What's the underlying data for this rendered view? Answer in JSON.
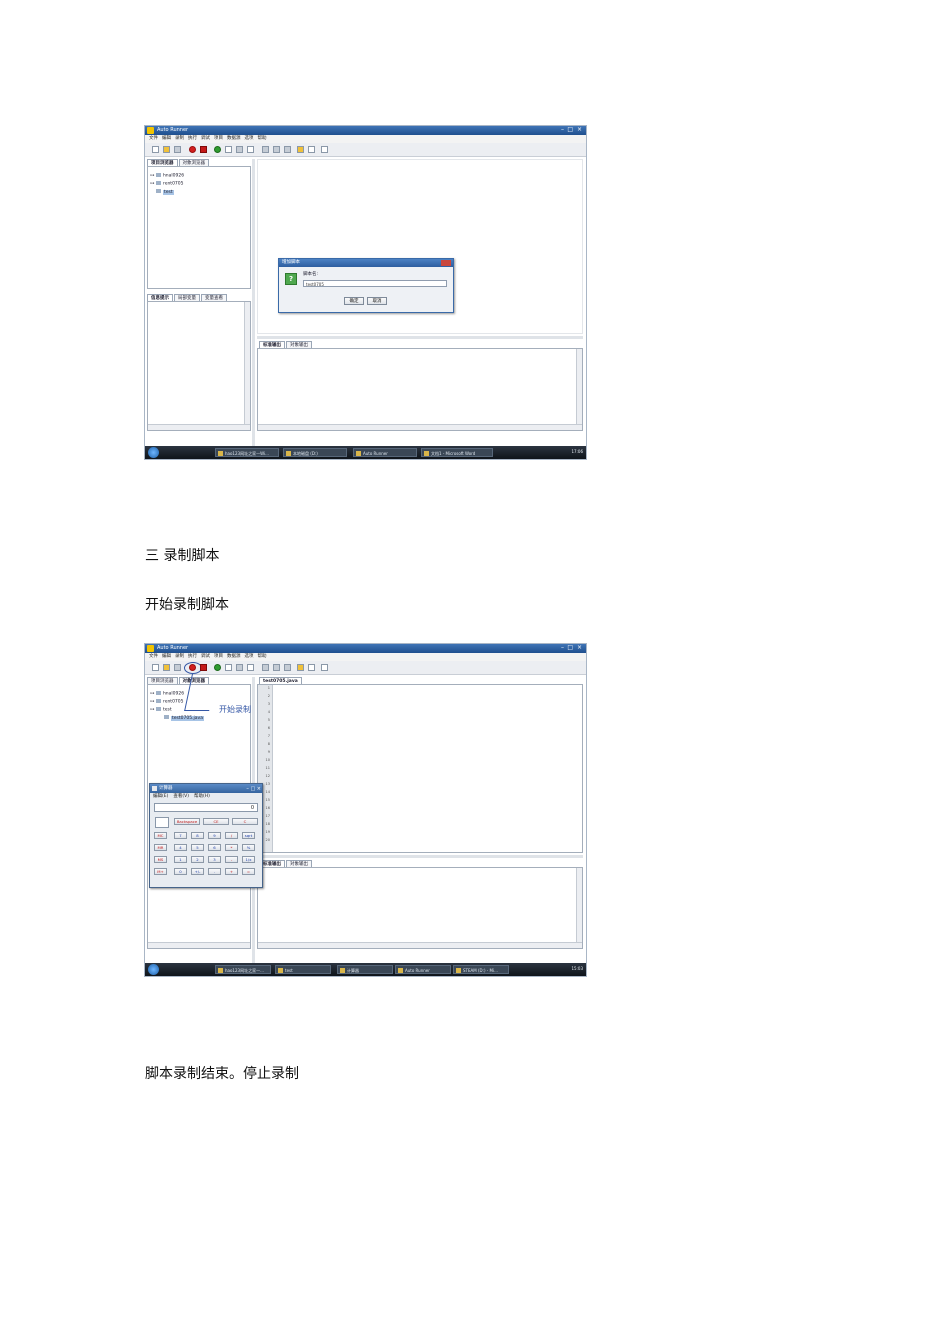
{
  "screenshot1": {
    "app_title": "Auto Runner",
    "menu": [
      "文件",
      "编辑",
      "录制",
      "执行",
      "调试",
      "项目",
      "数据源",
      "选项",
      "帮助"
    ],
    "left_tabs": [
      "项目浏览器",
      "对象浏览器"
    ],
    "tree": [
      "hnal0926",
      "rent0705",
      "test"
    ],
    "bottom_left_tabs": [
      "信息提示",
      "局部变量",
      "变量查看"
    ],
    "output_tabs": [
      "标准输出",
      "对象输出"
    ],
    "dialog": {
      "title": "增加脚本",
      "label": "脚本名:",
      "value": "test0705",
      "ok": "确定",
      "cancel": "取消"
    },
    "taskbar": [
      "hao123网址之家—Wi...",
      "本地磁盘 (D:)",
      "Auto Runner",
      "文档1 - Microsoft Word"
    ],
    "clock": "17:06"
  },
  "heading_section": "三  录制脚本",
  "para_start": "开始录制脚本",
  "screenshot2": {
    "app_title": "Auto Runner",
    "menu": [
      "文件",
      "编辑",
      "录制",
      "执行",
      "调试",
      "项目",
      "数据源",
      "选项",
      "帮助"
    ],
    "left_tabs": [
      "项目浏览器",
      "对象浏览器"
    ],
    "tree": [
      "hnal0926",
      "rent0705",
      "test",
      "test0705.java"
    ],
    "editor_tab": "test0705.java",
    "line_numbers": [
      "1",
      "2",
      "3",
      "4",
      "5",
      "6",
      "7",
      "8",
      "9",
      "10",
      "11",
      "12",
      "13",
      "14",
      "15",
      "16",
      "17",
      "18",
      "19",
      "20"
    ],
    "output_tabs": [
      "标准输出",
      "对象输出"
    ],
    "callout": "开始录制",
    "calculator": {
      "title": "计算器",
      "menu": [
        "编辑(E)",
        "查看(V)",
        "帮助(H)"
      ],
      "display": "0",
      "row0": [
        "Backspace",
        "CE",
        "C"
      ],
      "keys": [
        [
          "MC",
          "7",
          "8",
          "9",
          "/",
          "sqrt"
        ],
        [
          "MR",
          "4",
          "5",
          "6",
          "*",
          "%"
        ],
        [
          "MS",
          "1",
          "2",
          "3",
          "-",
          "1/x"
        ],
        [
          "M+",
          "0",
          "+/-",
          ".",
          "+",
          "="
        ]
      ]
    },
    "taskbar": [
      "hao123网址之家—...",
      "test",
      "计算器",
      "Auto Runner",
      "STEAM (D:) - Mi..."
    ],
    "clock": "15:03"
  },
  "para_end": "脚本录制结束。停止录制"
}
